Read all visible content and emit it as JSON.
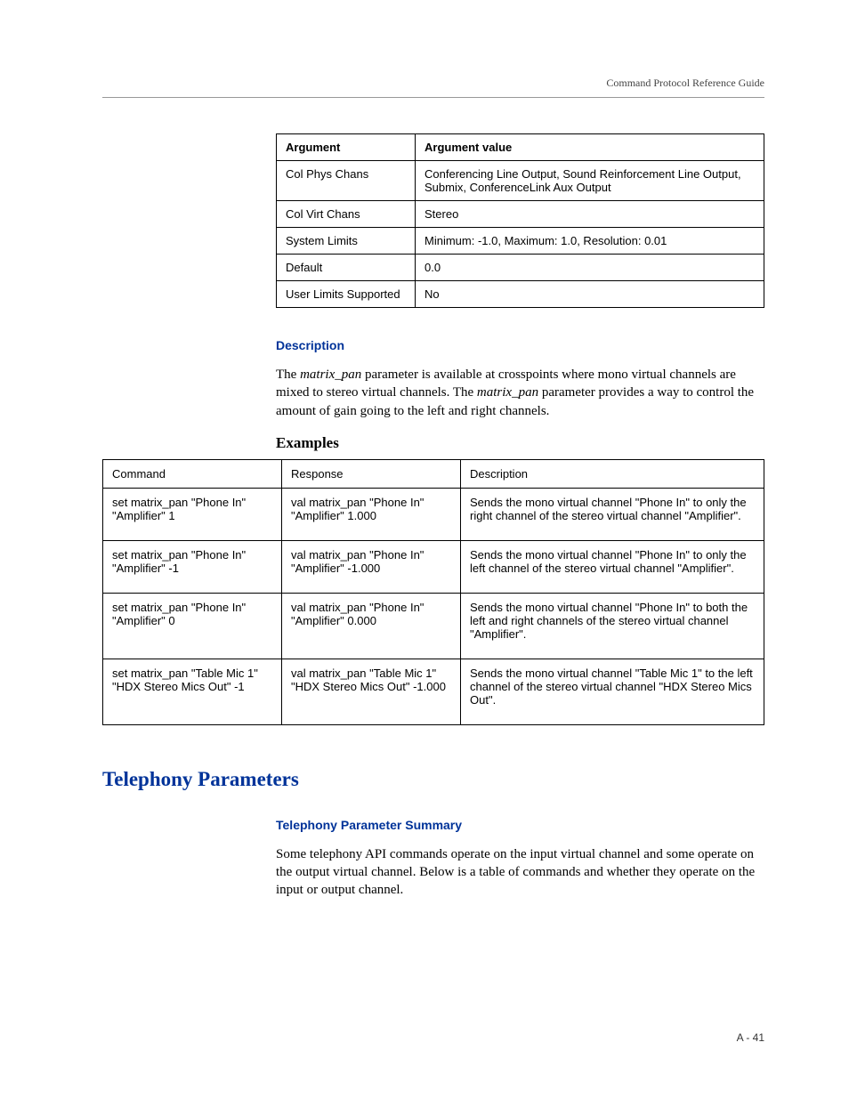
{
  "running_head": "Command Protocol Reference Guide",
  "arg_table": {
    "headers": [
      "Argument",
      "Argument value"
    ],
    "rows": [
      [
        "Col Phys Chans",
        "Conferencing Line Output, Sound Reinforcement Line Output, Submix, ConferenceLink Aux Output"
      ],
      [
        "Col Virt Chans",
        "Stereo"
      ],
      [
        "System Limits",
        "Minimum: -1.0, Maximum: 1.0, Resolution: 0.01"
      ],
      [
        "Default",
        "0.0"
      ],
      [
        "User Limits Supported",
        "No"
      ]
    ]
  },
  "description": {
    "heading": "Description",
    "text_pre": "The ",
    "text_em1": "matrix_pan",
    "text_mid": " parameter is available at crosspoints where mono virtual channels are mixed to stereo virtual channels. The ",
    "text_em2": "matrix_pan",
    "text_post": " parameter provides a way to control the amount of gain going to the left and right channels."
  },
  "examples": {
    "heading": "Examples",
    "headers": [
      "Command",
      "Response",
      "Description"
    ],
    "rows": [
      [
        "set matrix_pan \"Phone In\" \"Amplifier\" 1",
        "val matrix_pan \"Phone In\" \"Amplifier\" 1.000",
        "Sends the mono virtual channel \"Phone In\" to only the right channel of the stereo virtual channel \"Amplifier\"."
      ],
      [
        "set matrix_pan \"Phone In\" \"Amplifier\" -1",
        "val matrix_pan \"Phone In\" \"Amplifier\" -1.000",
        "Sends the mono virtual channel \"Phone In\" to only the left channel of the stereo virtual channel \"Amplifier\"."
      ],
      [
        "set matrix_pan \"Phone In\" \"Amplifier\" 0",
        "val matrix_pan \"Phone In\" \"Amplifier\" 0.000",
        "Sends the mono virtual channel \"Phone In\" to both the left and right channels of the stereo virtual channel \"Amplifier\"."
      ],
      [
        "set matrix_pan \"Table Mic 1\" \"HDX Stereo Mics Out\" -1",
        "val matrix_pan \"Table Mic 1\" \"HDX Stereo Mics Out\" -1.000",
        "Sends the mono virtual channel \"Table Mic 1\" to the left channel of the stereo virtual channel \"HDX Stereo Mics Out\"."
      ]
    ]
  },
  "telephony": {
    "heading": "Telephony Parameters",
    "sub_heading": "Telephony Parameter Summary",
    "body": "Some telephony API commands operate on the input virtual channel and some operate on the output virtual channel. Below is a table of commands and whether they operate on the input or output channel."
  },
  "page_num": "A - 41"
}
